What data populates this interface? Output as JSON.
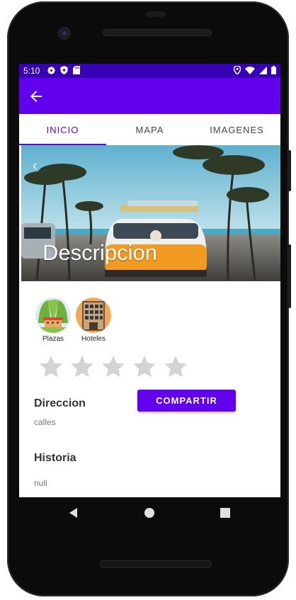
{
  "status_bar": {
    "time": "5:10"
  },
  "tabs": [
    {
      "label": "INICIO",
      "active": true
    },
    {
      "label": "MAPA",
      "active": false
    },
    {
      "label": "IMAGENES",
      "active": false
    }
  ],
  "hero": {
    "title": "Descripcion"
  },
  "categories": [
    {
      "label": "Plazas",
      "icon": "park-icon"
    },
    {
      "label": "Hoteles",
      "icon": "hotel-building-icon"
    }
  ],
  "rating": {
    "stars_total": 5,
    "stars_filled": 0
  },
  "direccion": {
    "label": "Direccion",
    "value": "calles"
  },
  "share_button": {
    "label": "COMPARTIR"
  },
  "historia": {
    "label": "Historia",
    "value": "null"
  },
  "colors": {
    "primary": "#6200ee",
    "status_bar": "#3700b3"
  }
}
